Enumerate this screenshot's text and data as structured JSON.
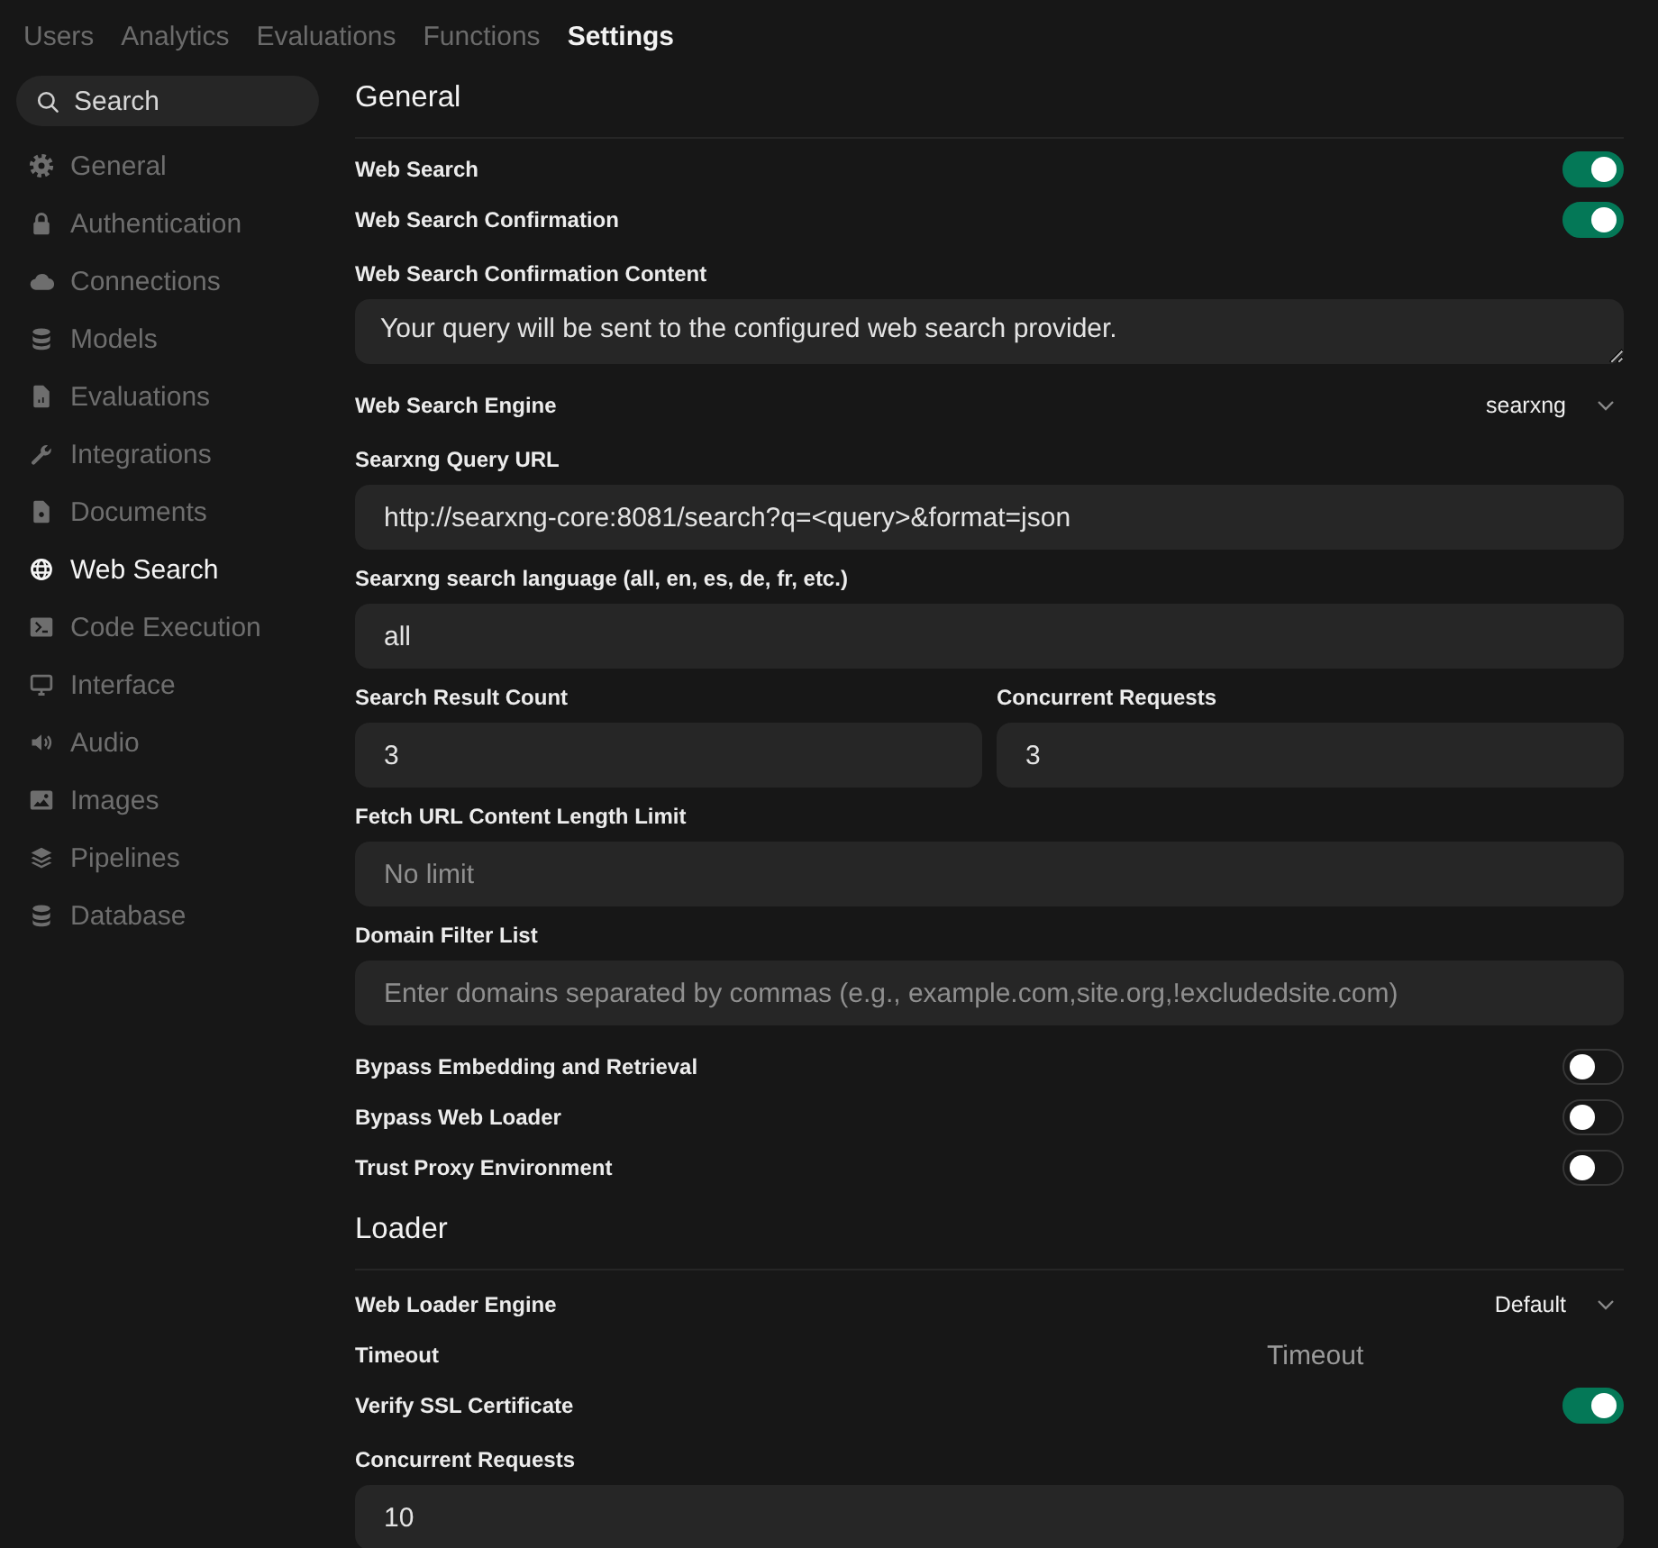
{
  "top_tabs": [
    {
      "label": "Users",
      "selected": false
    },
    {
      "label": "Analytics",
      "selected": false
    },
    {
      "label": "Evaluations",
      "selected": false
    },
    {
      "label": "Functions",
      "selected": false
    },
    {
      "label": "Settings",
      "selected": true
    }
  ],
  "sidebar": {
    "search": {
      "placeholder": "Search"
    },
    "items": [
      {
        "label": "General",
        "selected": false
      },
      {
        "label": "Authentication",
        "selected": false
      },
      {
        "label": "Connections",
        "selected": false
      },
      {
        "label": "Models",
        "selected": false
      },
      {
        "label": "Evaluations",
        "selected": false
      },
      {
        "label": "Integrations",
        "selected": false
      },
      {
        "label": "Documents",
        "selected": false
      },
      {
        "label": "Web Search",
        "selected": true
      },
      {
        "label": "Code Execution",
        "selected": false
      },
      {
        "label": "Interface",
        "selected": false
      },
      {
        "label": "Audio",
        "selected": false
      },
      {
        "label": "Images",
        "selected": false
      },
      {
        "label": "Pipelines",
        "selected": false
      },
      {
        "label": "Database",
        "selected": false
      }
    ]
  },
  "sections": [
    {
      "title": "General",
      "rows": [
        {
          "kind": "toggle",
          "label": "Web Search",
          "on": true
        },
        {
          "kind": "toggle",
          "label": "Web Search Confirmation",
          "on": true
        },
        {
          "kind": "textarea",
          "label": "Web Search Confirmation Content",
          "value": "Your query will be sent to the configured web search provider."
        },
        {
          "kind": "select",
          "label": "Web Search Engine",
          "value": "searxng"
        },
        {
          "kind": "input",
          "label": "Searxng Query URL",
          "value": "http://searxng-core:8081/search?q=<query>&format=json"
        },
        {
          "kind": "input",
          "label": "Searxng search language (all, en, es, de, fr, etc.)",
          "value": "all"
        },
        {
          "kind": "pair",
          "fields": [
            {
              "label": "Search Result Count",
              "value": "3"
            },
            {
              "label": "Concurrent Requests",
              "value": "3"
            }
          ]
        },
        {
          "kind": "input",
          "label": "Fetch URL Content Length Limit",
          "placeholder": "No limit"
        },
        {
          "kind": "input",
          "label": "Domain Filter List",
          "placeholder": "Enter domains separated by commas (e.g., example.com,site.org,!excludedsite.com)"
        },
        {
          "kind": "toggle",
          "label": "Bypass Embedding and Retrieval",
          "on": false
        },
        {
          "kind": "toggle",
          "label": "Bypass Web Loader",
          "on": false
        },
        {
          "kind": "toggle",
          "label": "Trust Proxy Environment",
          "on": false
        }
      ]
    },
    {
      "title": "Loader",
      "rows": [
        {
          "kind": "select",
          "label": "Web Loader Engine",
          "value": "Default"
        },
        {
          "kind": "inline_input",
          "label": "Timeout",
          "placeholder": "Timeout"
        },
        {
          "kind": "toggle",
          "label": "Verify SSL Certificate",
          "on": true
        },
        {
          "kind": "input",
          "label": "Concurrent Requests",
          "value": "10"
        }
      ]
    }
  ]
}
